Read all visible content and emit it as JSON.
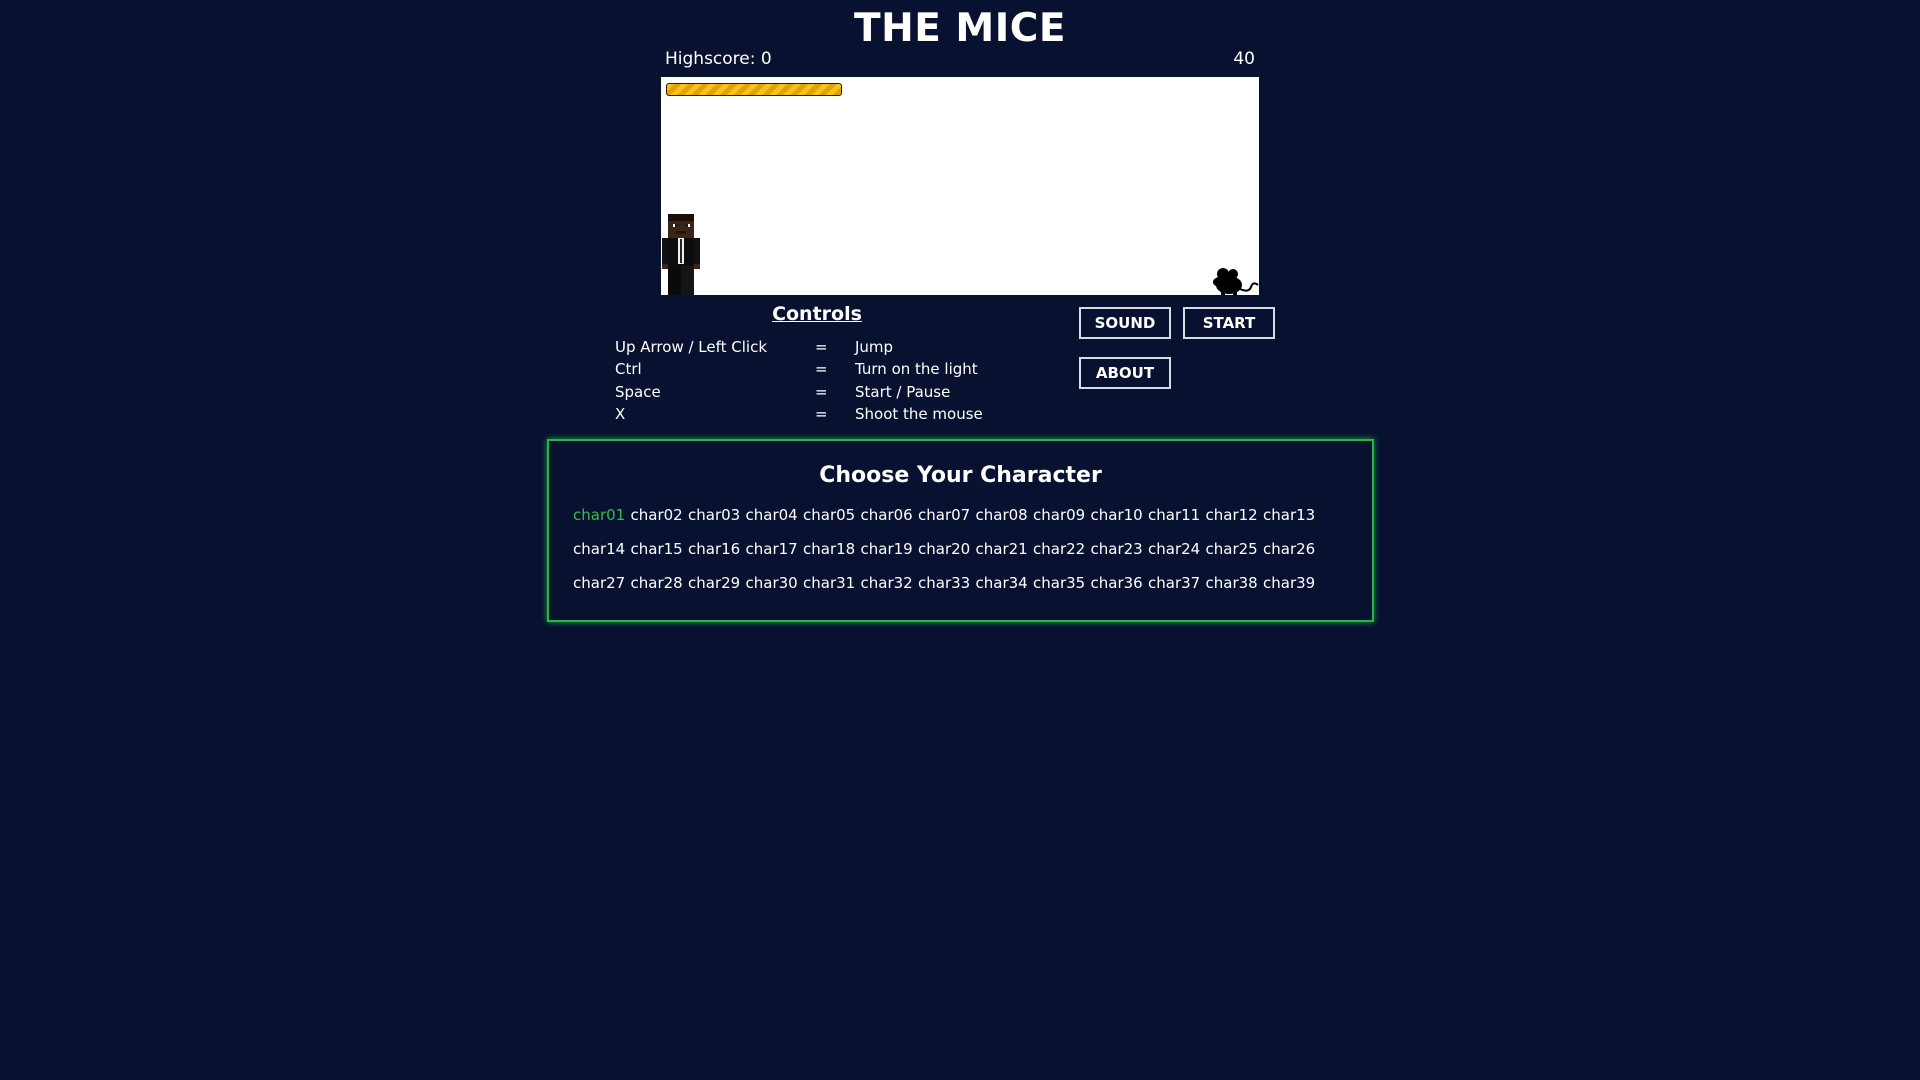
{
  "game": {
    "title": "THE MICE",
    "highscore_label": "Highscore: 0",
    "counter": "40",
    "light_level": 1.0
  },
  "controls": {
    "title": "Controls",
    "rows": [
      {
        "key": "Up Arrow / Left Click",
        "eq": "=",
        "action": "Jump"
      },
      {
        "key": "Ctrl",
        "eq": "=",
        "action": "Turn on the light"
      },
      {
        "key": "Space",
        "eq": "=",
        "action": "Start / Pause"
      },
      {
        "key": "X",
        "eq": "=",
        "action": "Shoot the mouse"
      }
    ]
  },
  "buttons": {
    "sound": "SOUND",
    "start": "START",
    "about": "ABOUT"
  },
  "chooser": {
    "title": "Choose Your Character",
    "selected": "char01",
    "characters": [
      "char01",
      "char02",
      "char03",
      "char04",
      "char05",
      "char06",
      "char07",
      "char08",
      "char09",
      "char10",
      "char11",
      "char12",
      "char13",
      "char14",
      "char15",
      "char16",
      "char17",
      "char18",
      "char19",
      "char20",
      "char21",
      "char22",
      "char23",
      "char24",
      "char25",
      "char26",
      "char27",
      "char28",
      "char29",
      "char30",
      "char31",
      "char32",
      "char33",
      "char34",
      "char35",
      "char36",
      "char37",
      "char38",
      "char39"
    ]
  },
  "colors": {
    "background": "#081130",
    "accent_green": "#2fbf4a",
    "light_bar": "#f7c21f"
  },
  "icons": {
    "player": "player-character-sprite",
    "mouse": "mouse-silhouette-icon"
  }
}
